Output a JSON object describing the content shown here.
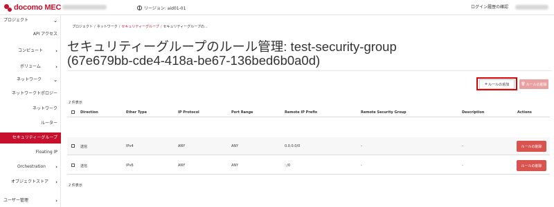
{
  "header": {
    "brand": "docomo MEC",
    "region": "リージョン: aid01-01",
    "login_history": "ログイン履歴の確認"
  },
  "sidebar": {
    "items": [
      {
        "label": "プロジェクト",
        "chevron": "⌄"
      },
      {
        "label": "API アクセス",
        "chevron": ""
      },
      {
        "label": "コンピュート",
        "chevron": "›"
      },
      {
        "label": "ボリューム",
        "chevron": "›"
      },
      {
        "label": "ネットワーク",
        "chevron": "⌄"
      },
      {
        "label": "ネットワークトポロジー",
        "chevron": ""
      },
      {
        "label": "ネットワーク",
        "chevron": ""
      },
      {
        "label": "ルーター",
        "chevron": ""
      },
      {
        "label": "セキュリティーグループ",
        "chevron": ""
      },
      {
        "label": "Floating IP",
        "chevron": ""
      },
      {
        "label": "Orchestration",
        "chevron": "›"
      },
      {
        "label": "オブジェクトストア",
        "chevron": "›"
      },
      {
        "label": "ユーザー管理",
        "chevron": "›"
      }
    ]
  },
  "breadcrumb": {
    "items": [
      "プロジェクト",
      "ネットワーク",
      "セキュリティーグループ",
      "セキュリティーグループの..."
    ],
    "separator": "/"
  },
  "page_title": "セキュリティーグループのルール管理: test-security-group (67e679bb-cde4-418a-be67-136bed6b0a0d)",
  "toolbar": {
    "add_label": "ルールの追加",
    "add_icon": "plus-icon",
    "delete_label": "ルールの削除",
    "delete_icon": "trash-icon"
  },
  "count_top": "2 件表示",
  "count_bottom": "2 件表示",
  "table": {
    "columns": [
      "Direction",
      "Ether Type",
      "IP Protocol",
      "Port Range",
      "Remote IP Prefix",
      "Remote Security Group",
      "Description",
      "Actions"
    ],
    "rows": [
      {
        "direction": "送信",
        "ether_type": "IPv4",
        "ip_protocol": "ANY",
        "port_range": "ANY",
        "remote_ip_prefix": "0.0.0.0/0",
        "remote_security_group": "-",
        "description": "-",
        "action": "ルールの削除"
      },
      {
        "direction": "送信",
        "ether_type": "IPv6",
        "ip_protocol": "ANY",
        "port_range": "ANY",
        "remote_ip_prefix": "::/0",
        "remote_security_group": "-",
        "description": "-",
        "action": "ルールの削除"
      }
    ]
  },
  "colors": {
    "brand": "#c8102e",
    "highlight": "#e00000",
    "danger": "#d9534f"
  }
}
